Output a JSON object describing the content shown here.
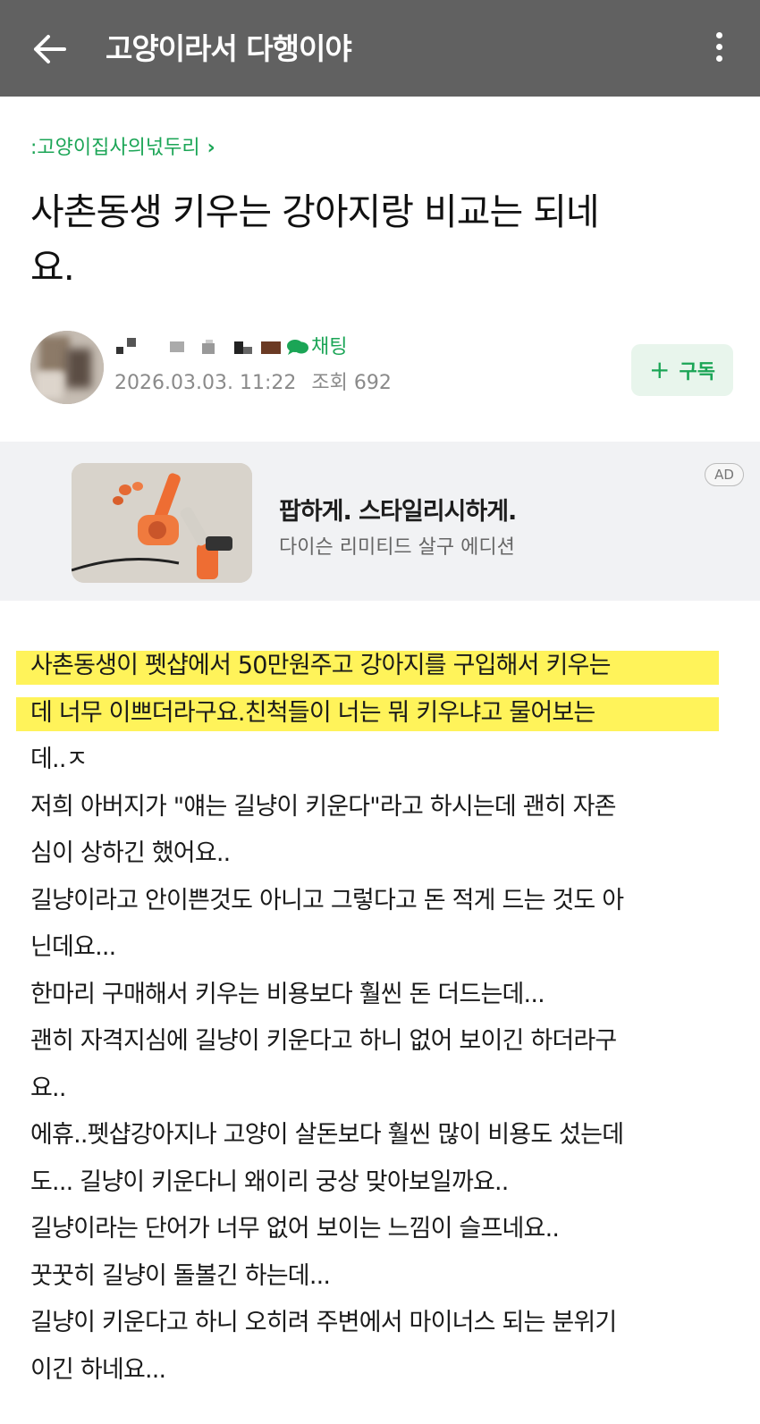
{
  "topbar": {
    "title": "고양이라서 다행이야"
  },
  "post": {
    "board": ":고양이집사의넋두리",
    "title_lines": [
      "사촌동생 키우는 강아지랑 비교는 되네",
      "요."
    ],
    "author": {
      "chat_label": "채팅",
      "date": "2026.03.03. 11:22",
      "views_label": "조회 692"
    },
    "subscribe_label": "구독"
  },
  "ad": {
    "badge": "AD",
    "headline": "팝하게. 스타일리시하게.",
    "subline": "다이슨 리미티드 살구 에디션"
  },
  "body_lines": [
    "사촌동생이 펫샵에서 50만원주고 강아지를 구입해서 키우는",
    "데 너무 이쁘더라구요.친척들이 너는 뭐 키우냐고 물어보는",
    "데..ㅈ",
    "저희 아버지가 \"얘는 길냥이 키운다\"라고 하시는데 괜히 자존",
    "심이 상하긴 했어요..",
    "길냥이라고 안이쁜것도 아니고 그렇다고 돈 적게 드는 것도 아",
    "닌데요...",
    "한마리 구매해서 키우는 비용보다 훨씬 돈 더드는데...",
    "괜히 자격지심에 길냥이 키운다고 하니 없어 보이긴 하더라구",
    "요..",
    "에휴..펫샵강아지나 고양이 살돈보다 훨씬 많이 비용도 섰는데",
    "도... 길냥이 키운다니 왜이리 궁상 맞아보일까요..",
    "길냥이라는 단어가 너무 없어 보이는 느낌이 슬프네요..",
    "꿋꿋히 길냥이 돌볼긴 하는데...",
    "길냥이 키운다고 하니 오히려 주변에서 마이너스 되는 분위기",
    "이긴 하네요..."
  ],
  "colors": {
    "topbar": "#616161",
    "accent_green": "#1ba556",
    "highlight": "#fff35a",
    "ad_bg": "#f1f2f4"
  },
  "icons": [
    "arrow-left-icon",
    "more-vert-icon",
    "chevron-right-icon",
    "chat-bubble-icon",
    "plus-icon"
  ]
}
